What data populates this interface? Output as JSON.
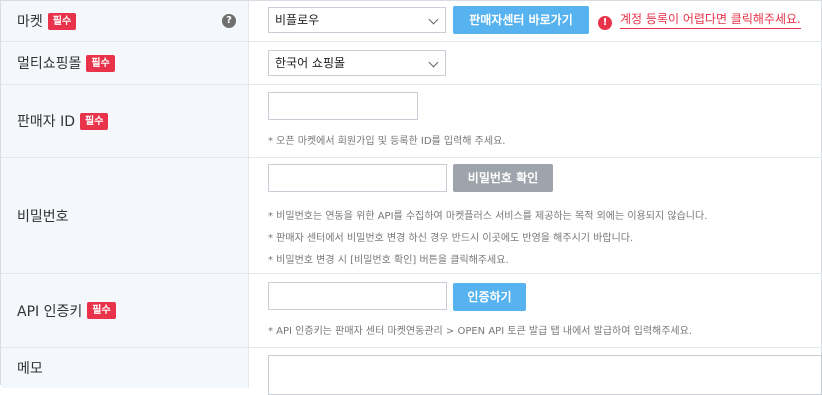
{
  "market": {
    "label": "마켓",
    "required": "필수",
    "help": "?",
    "select_value": "비플로우",
    "button": "판매자센터 바로가기",
    "warning_icon": "!",
    "warning": "계정 등록이 어렵다면 클릭해주세요."
  },
  "multimall": {
    "label": "멀티쇼핑몰",
    "required": "필수",
    "select_value": "한국어 쇼핑몰"
  },
  "seller_id": {
    "label": "판매자 ID",
    "required": "필수",
    "value": "",
    "note": "* 오픈 마켓에서 회원가입 및 등록한 ID를 입력해 주세요."
  },
  "password": {
    "label": "비밀번호",
    "value": "",
    "button": "비밀번호 확인",
    "notes": [
      "* 비밀번호는 연동을 위한 API를 수집하여 마켓플러스 서비스를 제공하는 목적 외에는 이용되지 않습니다.",
      "* 판매자 센터에서 비밀번호 변경 하신 경우 반드시 이곳에도 반영을 해주시기 바랍니다.",
      "* 비밀번호 변경 시 [비밀번호 확인] 버튼을 클릭해주세요."
    ]
  },
  "api_key": {
    "label": "API 인증키",
    "required": "필수",
    "value": "",
    "button": "인증하기",
    "note": "* API 인증키는 판매자 센터 마켓연동관리 > OPEN API 토큰 발급 탭 내에서 발급하여 입력해주세요."
  },
  "memo": {
    "label": "메모",
    "value": ""
  },
  "colors": {
    "required_badge": "#e8334a",
    "primary_button": "#57b3f0",
    "secondary_button": "#9ea4ab",
    "label_bg": "#f4f7fb"
  }
}
